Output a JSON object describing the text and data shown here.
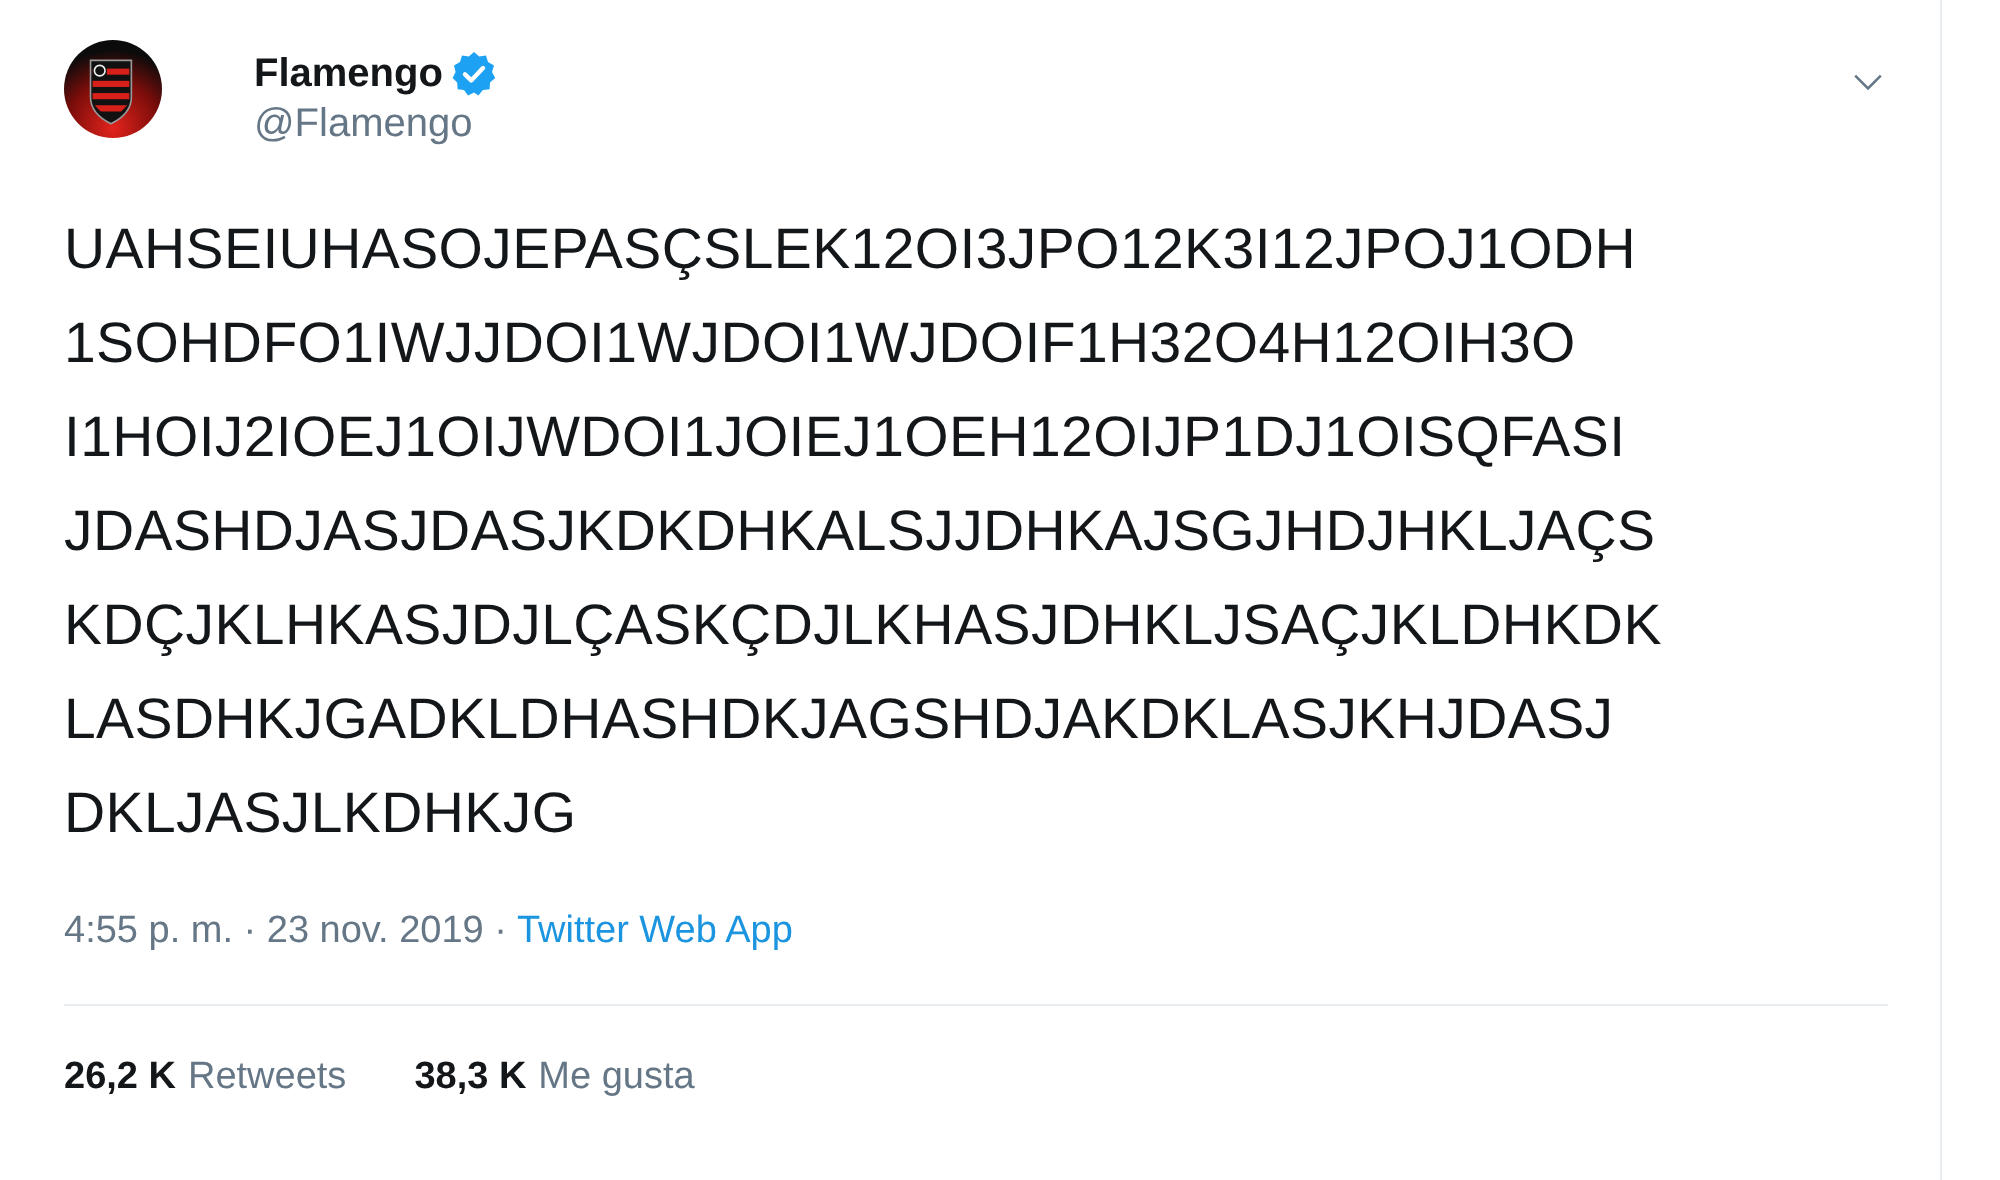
{
  "tweet": {
    "author": {
      "name": "Flamengo",
      "verified": true,
      "handle": "@Flamengo"
    },
    "text_lines": [
      "UAHSEIUHASOJEPASÇSLEK12OI3JPO12K3I12JPOJ1ODH",
      "1SOHDFO1IWJJDOI1WJDOI1WJDOIF1H32O4H12OIH3O",
      "I1HOIJ2IOEJ1OIJWDOI1JOIEJ1OEH12OIJP1DJ1OISQFASI",
      "JDASHDJASJDASJKDKDHKALSJJDHKAJSGJHDJHKLJAÇS",
      "KDÇJKLHKASJDJLÇASKÇDJLKHASJDHKLJSAÇJKLDHKDK",
      "LASDHKJGADKLDHASHDKJAGSHDJAKDKLASJKHJDASJ",
      "DKLJASJLKDHKJG"
    ],
    "timestamp": "4:55 p. m. · 23 nov. 2019 ·",
    "source": "Twitter Web App",
    "stats": [
      {
        "count": "26,2 K",
        "label": "Retweets"
      },
      {
        "count": "38,3 K",
        "label": "Me gusta"
      }
    ]
  }
}
